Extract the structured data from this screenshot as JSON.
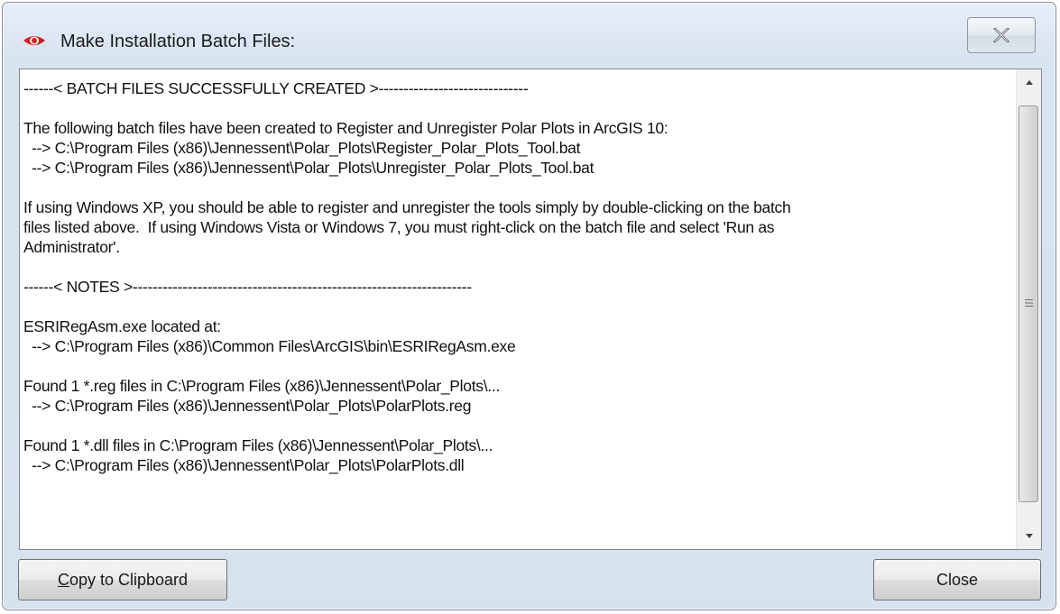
{
  "window": {
    "title": "Make Installation Batch Files:"
  },
  "icons": {
    "app": "red-eye-icon",
    "close": "close-x-icon",
    "scroll_up": "arrow-up-icon",
    "scroll_down": "arrow-down-icon",
    "scroll_grip": "grip-icon"
  },
  "content": {
    "lines": [
      "------< BATCH FILES SUCCESSFULLY CREATED >------------------------------",
      "",
      "The following batch files have been created to Register and Unregister Polar Plots in ArcGIS 10:",
      "  --> C:\\Program Files (x86)\\Jennessent\\Polar_Plots\\Register_Polar_Plots_Tool.bat",
      "  --> C:\\Program Files (x86)\\Jennessent\\Polar_Plots\\Unregister_Polar_Plots_Tool.bat",
      "",
      "If using Windows XP, you should be able to register and unregister the tools simply by double-clicking on the batch",
      "files listed above.  If using Windows Vista or Windows 7, you must right-click on the batch file and select 'Run as",
      "Administrator'.",
      "",
      "------< NOTES >--------------------------------------------------------------------",
      "",
      "ESRIRegAsm.exe located at:",
      "  --> C:\\Program Files (x86)\\Common Files\\ArcGIS\\bin\\ESRIRegAsm.exe",
      "",
      "Found 1 *.reg files in C:\\Program Files (x86)\\Jennessent\\Polar_Plots\\...",
      "  --> C:\\Program Files (x86)\\Jennessent\\Polar_Plots\\PolarPlots.reg",
      "",
      "Found 1 *.dll files in C:\\Program Files (x86)\\Jennessent\\Polar_Plots\\...",
      "  --> C:\\Program Files (x86)\\Jennessent\\Polar_Plots\\PolarPlots.dll"
    ]
  },
  "buttons": {
    "copy_mnemonic": "C",
    "copy_rest": "opy to Clipboard",
    "close": "Close"
  },
  "colors": {
    "icon_red": "#d81e1e",
    "window_bg": "#d9e4f1"
  }
}
